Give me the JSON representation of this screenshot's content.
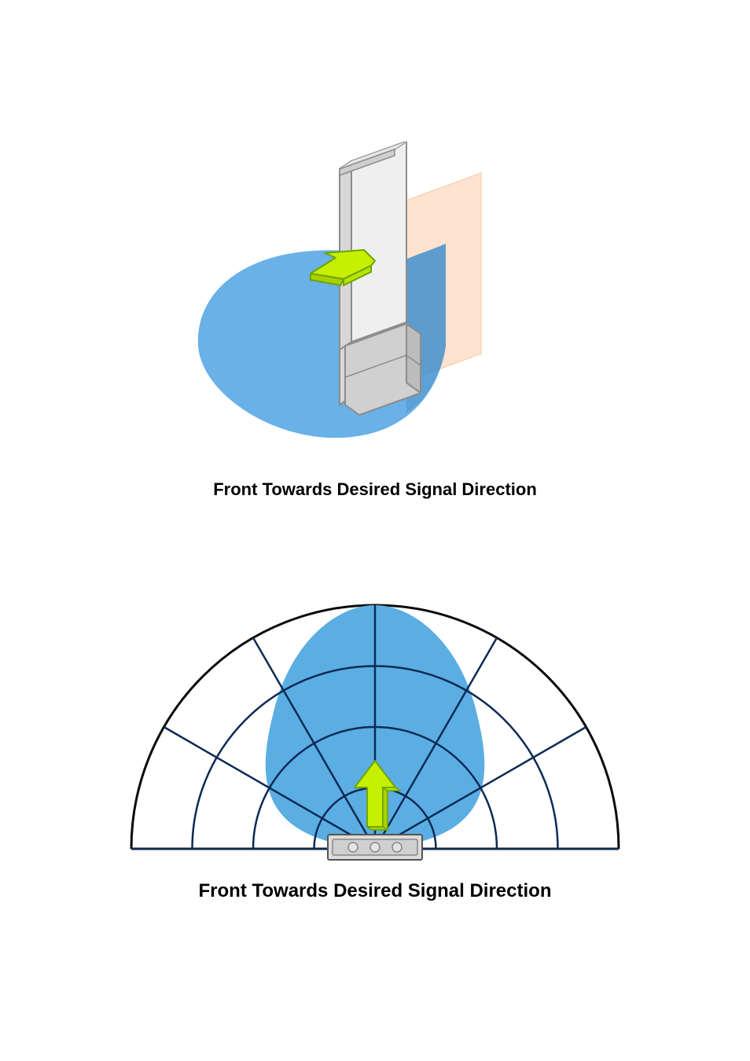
{
  "figure_top": {
    "caption": "Front Towards Desired Signal Direction",
    "colors": {
      "beam": "#4aa3e0",
      "beam_opacity": 0.75,
      "wall": "#ffe3d0",
      "wall_outline": "#f6c7a6",
      "device_body": "#efefef",
      "device_outline": "#9c9c9c",
      "device_base": "#bfbfbf",
      "arrow_fill": "#c7f200",
      "arrow_outline": "#6aa000",
      "background": "#ffffff"
    },
    "semantic": {
      "device": "directional-antenna-unit",
      "mounting": "wall-mount-panel",
      "beam": "antenna-radiation-beam",
      "arrow": "signal-direction-arrow"
    }
  },
  "figure_bottom": {
    "caption": "Front Towards Desired Signal Direction",
    "colors": {
      "beam": "#5aaee3",
      "grid": "#0a0a0a",
      "grid_inner": "#1a3b6e",
      "device_body": "#d9d9d9",
      "device_outline": "#555555",
      "arrow_fill": "#c7f200",
      "arrow_outline": "#7ab000",
      "background": "#ffffff"
    },
    "polar_grid": {
      "rings": 4,
      "angle_step_deg": 30,
      "angle_range_deg": 180
    },
    "beam_lobe": {
      "approx_half_beamwidth_deg": 60,
      "relative_peak_radius": 0.95
    },
    "semantic": {
      "grid": "polar-radiation-grid",
      "beam": "antenna-radiation-pattern",
      "device": "antenna-top-view",
      "arrow": "signal-direction-arrow"
    }
  }
}
